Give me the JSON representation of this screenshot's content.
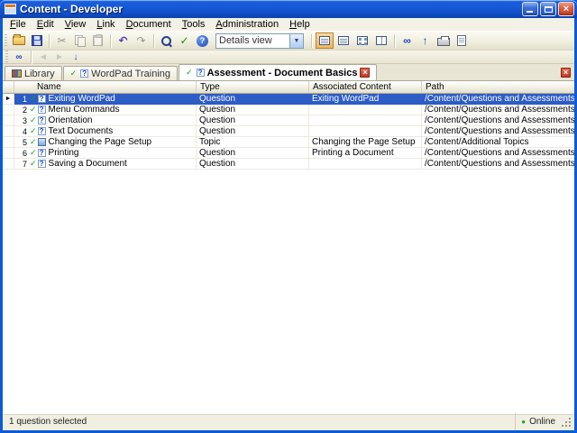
{
  "window": {
    "title": "Content - Developer",
    "close_glyph": "×"
  },
  "menubar": {
    "items": [
      "File",
      "Edit",
      "View",
      "Link",
      "Document",
      "Tools",
      "Administration",
      "Help"
    ]
  },
  "toolbar": {
    "details_view_combo": {
      "value": "Details view",
      "arrow": "▼"
    },
    "glyphs": {
      "cut": "✂",
      "undo": "↶",
      "redo": "↷",
      "spellcheck": "✓",
      "help": "?",
      "link": "∞",
      "back": "◄",
      "forward": "►",
      "up": "↑",
      "down": "↓",
      "close": "×"
    }
  },
  "tabs": [
    {
      "label": "Library"
    },
    {
      "label": "WordPad Training"
    },
    {
      "label": "Assessment - Document Basics",
      "close": "×"
    }
  ],
  "table": {
    "columns": [
      "Name",
      "Type",
      "Associated Content",
      "Path"
    ],
    "row_marker": "►",
    "rows": [
      {
        "num": "1",
        "icon": "question",
        "name": "Exiting WordPad",
        "type": "Question",
        "associated": "Exiting WordPad",
        "path": "/Content/Questions and Assessments",
        "selected": true
      },
      {
        "num": "2",
        "icon": "question",
        "name": "Menu Commands",
        "type": "Question",
        "associated": "",
        "path": "/Content/Questions and Assessments",
        "selected": false
      },
      {
        "num": "3",
        "icon": "question",
        "name": "Orientation",
        "type": "Question",
        "associated": "",
        "path": "/Content/Questions and Assessments",
        "selected": false
      },
      {
        "num": "4",
        "icon": "question",
        "name": "Text Documents",
        "type": "Question",
        "associated": "",
        "path": "/Content/Questions and Assessments",
        "selected": false
      },
      {
        "num": "5",
        "icon": "topic",
        "name": "Changing the Page Setup",
        "type": "Topic",
        "associated": "Changing the Page Setup",
        "path": "/Content/Additional Topics",
        "selected": false
      },
      {
        "num": "6",
        "icon": "question",
        "name": "Printing",
        "type": "Question",
        "associated": "Printing a Document",
        "path": "/Content/Questions and Assessments",
        "selected": false
      },
      {
        "num": "7",
        "icon": "question",
        "name": "Saving a Document",
        "type": "Question",
        "associated": "",
        "path": "/Content/Questions and Assessments",
        "selected": false
      }
    ]
  },
  "statusbar": {
    "left": "1 question selected",
    "right": "Online",
    "online_dot": "●"
  },
  "icon_glyph_q": "?",
  "colors": {
    "selection": "#2c5cc5",
    "titlebar": "#1659d6",
    "online_green": "#1ca61c",
    "close_red": "#c03a22"
  }
}
